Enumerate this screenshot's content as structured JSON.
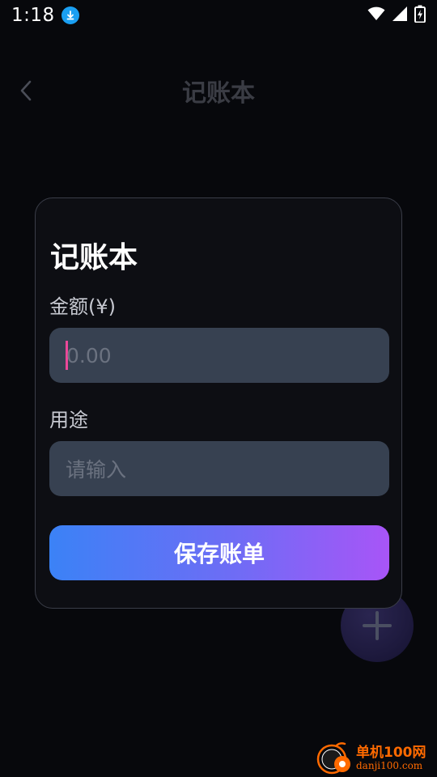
{
  "status_bar": {
    "time": "1:18",
    "icons": [
      "download-icon",
      "wifi-icon",
      "signal-icon",
      "battery-icon"
    ]
  },
  "header": {
    "title": "记账本",
    "back_icon": "chevron-left-icon"
  },
  "dialog": {
    "title": "记账本",
    "amount_label": "金额(¥)",
    "amount_placeholder": "0.00",
    "purpose_label": "用途",
    "purpose_placeholder": "请输入",
    "save_label": "保存账单"
  },
  "fab": {
    "icon": "plus-icon"
  },
  "watermark": {
    "name": "单机100网",
    "url": "danji100.com"
  },
  "colors": {
    "background": "#07080c",
    "dialog_bg": "#0d0e13",
    "input_bg": "#374151",
    "cursor": "#ec4899",
    "button_gradient_start": "#3b82f6",
    "button_gradient_end": "#a855f7",
    "watermark": "#ff6a00"
  }
}
